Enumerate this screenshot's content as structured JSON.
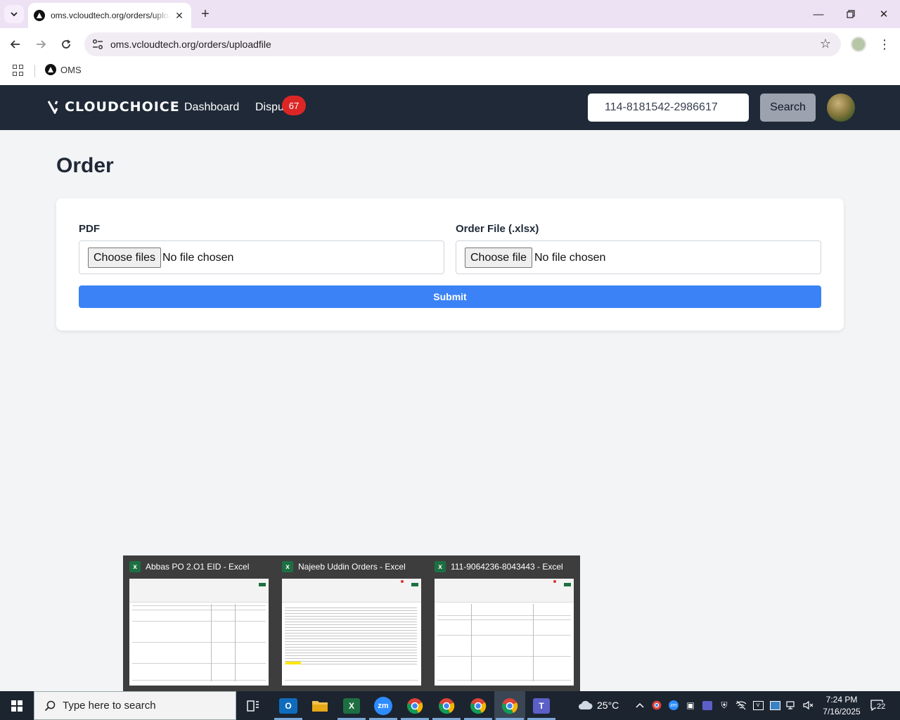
{
  "browser": {
    "tab_title": "oms.vcloudtech.org/orders/uploadfile",
    "url": "oms.vcloudtech.org/orders/uploadfile",
    "bookmarks": [
      {
        "label": "OMS"
      }
    ]
  },
  "header": {
    "logo_text": "CLOUDCHOICE",
    "nav": [
      {
        "label": "Dashboard"
      },
      {
        "label": "Dispu",
        "badge": "67"
      }
    ],
    "search": {
      "value": "114-8181542-2986617",
      "button_label": "Search"
    }
  },
  "main": {
    "title": "Order",
    "pdf": {
      "label": "PDF",
      "button_label": "Choose files",
      "status": "No file chosen"
    },
    "order_file": {
      "label": "Order File (.xlsx)",
      "button_label": "Choose file",
      "status": "No file chosen"
    },
    "submit_label": "Submit"
  },
  "taskbar_previews": [
    {
      "title": "Abbas PO 2.O1  EID - Excel",
      "style": "sparse"
    },
    {
      "title": "Najeeb Uddin Orders - Excel",
      "style": "dense"
    },
    {
      "title": "111-9064236-8043443 - Excel",
      "style": "sparse"
    }
  ],
  "taskbar": {
    "search_placeholder": "Type here to search",
    "apps": [
      {
        "name": "task-view",
        "label": ""
      },
      {
        "name": "outlook",
        "label": "O",
        "color": "#0f6cbd"
      },
      {
        "name": "file-explorer",
        "label": "",
        "color": "#f2c14e"
      },
      {
        "name": "excel",
        "label": "X",
        "color": "#1d6f42"
      },
      {
        "name": "zoom",
        "label": "zm",
        "color": "#2d8cff"
      },
      {
        "name": "chrome-1",
        "label": "",
        "color": "#db4437"
      },
      {
        "name": "chrome-2",
        "label": "",
        "color": "#db4437"
      },
      {
        "name": "chrome-3",
        "label": "",
        "color": "#db4437"
      },
      {
        "name": "chrome-4",
        "label": "",
        "color": "#db4437"
      },
      {
        "name": "teams",
        "label": "T",
        "color": "#5b5fc7"
      }
    ],
    "weather_temp": "25°C",
    "time": "7:24 PM",
    "date": "7/16/2025",
    "notification_count": "22"
  },
  "colors": {
    "appbar": "#1f2937",
    "badge": "#dc2626",
    "submit": "#3b82f6",
    "search_button": "#9ca3af"
  }
}
